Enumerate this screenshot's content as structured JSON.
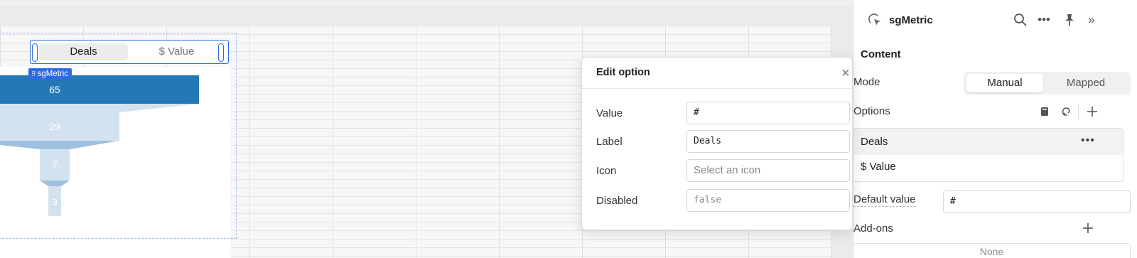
{
  "canvas": {
    "widget": {
      "toggle": {
        "selected": "Deals",
        "other": "$ Value"
      },
      "tag": "sgMetric",
      "funnel_values": [
        "65",
        "29",
        "7",
        "3"
      ]
    }
  },
  "popover": {
    "title": "Edit option",
    "fields": [
      {
        "label": "Value",
        "value": "#"
      },
      {
        "label": "Label",
        "value": "Deals"
      },
      {
        "label": "Icon",
        "placeholder": "Select an icon"
      },
      {
        "label": "Disabled",
        "value": "false"
      }
    ]
  },
  "panel": {
    "title": "sgMetric",
    "content_section": "Content",
    "mode": {
      "label": "Mode",
      "options": [
        "Manual",
        "Mapped"
      ],
      "selected": "Manual"
    },
    "options_section": {
      "label": "Options",
      "items": [
        "Deals",
        "$ Value"
      ]
    },
    "default_value": {
      "label": "Default value",
      "value": "#"
    },
    "addons": {
      "label": "Add-ons",
      "value": "None"
    }
  },
  "colors": {
    "accent": "#2d6be0",
    "funnel_dark": "#2378b5",
    "funnel_light": "#d3e2ef",
    "funnel_mid": "#9fc0df"
  }
}
